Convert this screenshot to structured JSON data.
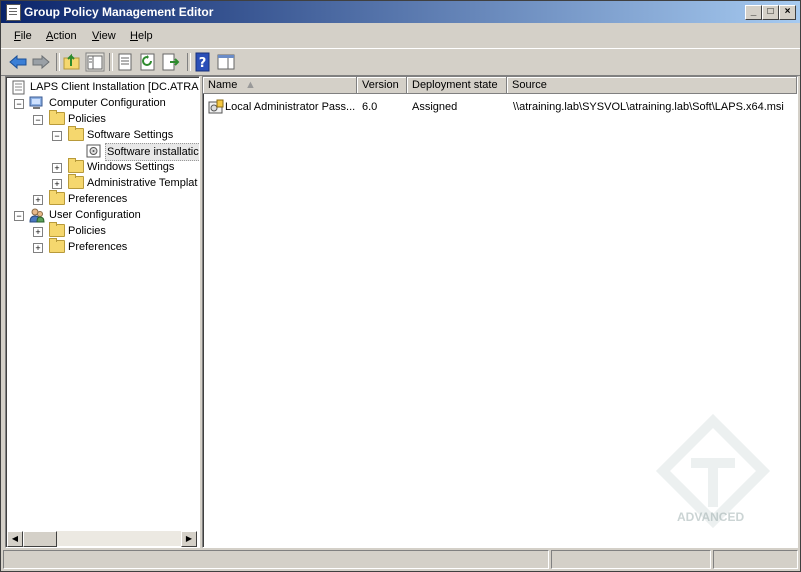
{
  "window": {
    "title": "Group Policy Management Editor"
  },
  "menubar": {
    "items": [
      {
        "label": "File",
        "u": "F",
        "rest": "ile"
      },
      {
        "label": "Action",
        "u": "A",
        "rest": "ction"
      },
      {
        "label": "View",
        "u": "V",
        "rest": "iew"
      },
      {
        "label": "Help",
        "u": "H",
        "rest": "elp"
      }
    ]
  },
  "tree": {
    "root": "LAPS Client Installation [DC.ATRAI",
    "computer_configuration": "Computer Configuration",
    "policies": "Policies",
    "software_settings": "Software Settings",
    "software_installation": "Software installatic",
    "windows_settings": "Windows Settings",
    "administrative_templates": "Administrative Templat",
    "preferences": "Preferences",
    "user_configuration": "User Configuration",
    "user_policies": "Policies",
    "user_preferences": "Preferences"
  },
  "list": {
    "columns": [
      "Name",
      "Version",
      "Deployment state",
      "Source"
    ],
    "rows": [
      {
        "name": "Local Administrator Pass...",
        "version": "6.0",
        "deployment_state": "Assigned",
        "source": "\\\\atraining.lab\\SYSVOL\\atraining.lab\\Soft\\LAPS.x64.msi"
      }
    ]
  },
  "watermark": {
    "text": "ADVANCED"
  },
  "colors": {
    "titlebar_start": "#0a246a",
    "titlebar_end": "#a6caf0",
    "chrome": "#d4d0c8"
  }
}
